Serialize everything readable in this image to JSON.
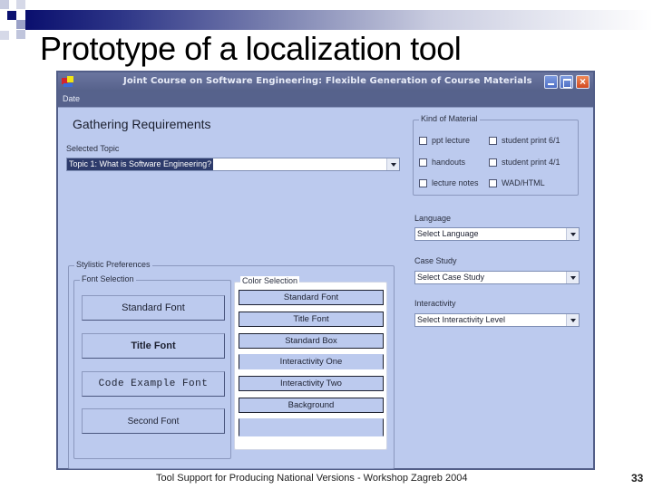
{
  "slide": {
    "title": "Prototype of a localization tool",
    "footer": "Tool Support for Producing National Versions - Workshop Zagreb 2004",
    "page_number": "33"
  },
  "window": {
    "title": "Joint Course on Software Engineering: Flexible Generation of Course Materials",
    "menu": [
      "Date"
    ],
    "controls": {
      "minimize": "minimize-icon",
      "maximize": "maximize-icon",
      "close": "×"
    }
  },
  "form": {
    "heading": "Gathering Requirements",
    "topic": {
      "label": "Selected Topic",
      "value": "Topic 1: What is Software Engineering?"
    },
    "kind_of_material": {
      "title": "Kind of Material",
      "options": [
        {
          "label": "ppt lecture",
          "checked": false
        },
        {
          "label": "student print 6/1",
          "checked": false
        },
        {
          "label": "handouts",
          "checked": false
        },
        {
          "label": "student print 4/1",
          "checked": false
        },
        {
          "label": "lecture notes",
          "checked": false
        },
        {
          "label": "WAD/HTML",
          "checked": false
        }
      ]
    },
    "language": {
      "label": "Language",
      "value": "Select Language"
    },
    "case_study": {
      "label": "Case Study",
      "value": "Select Case Study"
    },
    "interactivity": {
      "label": "Interactivity",
      "value": "Select Interactivity Level"
    },
    "stylistic": {
      "title": "Stylistic Preferences",
      "font_selection": {
        "title": "Font Selection",
        "buttons": [
          "Standard Font",
          "Title Font",
          "Code Example Font",
          "Second Font"
        ]
      },
      "color_selection": {
        "title": "Color Selection",
        "buttons": [
          "Standard Font",
          "Title Font",
          "Standard Box",
          "Interactivity One",
          "Interactivity Two",
          "Background",
          ""
        ]
      }
    }
  },
  "colors": {
    "window_bg": "#bccaee",
    "titlebar": "#5a6690",
    "close_button": "#d24a20",
    "selection": "#2d3b6b"
  }
}
